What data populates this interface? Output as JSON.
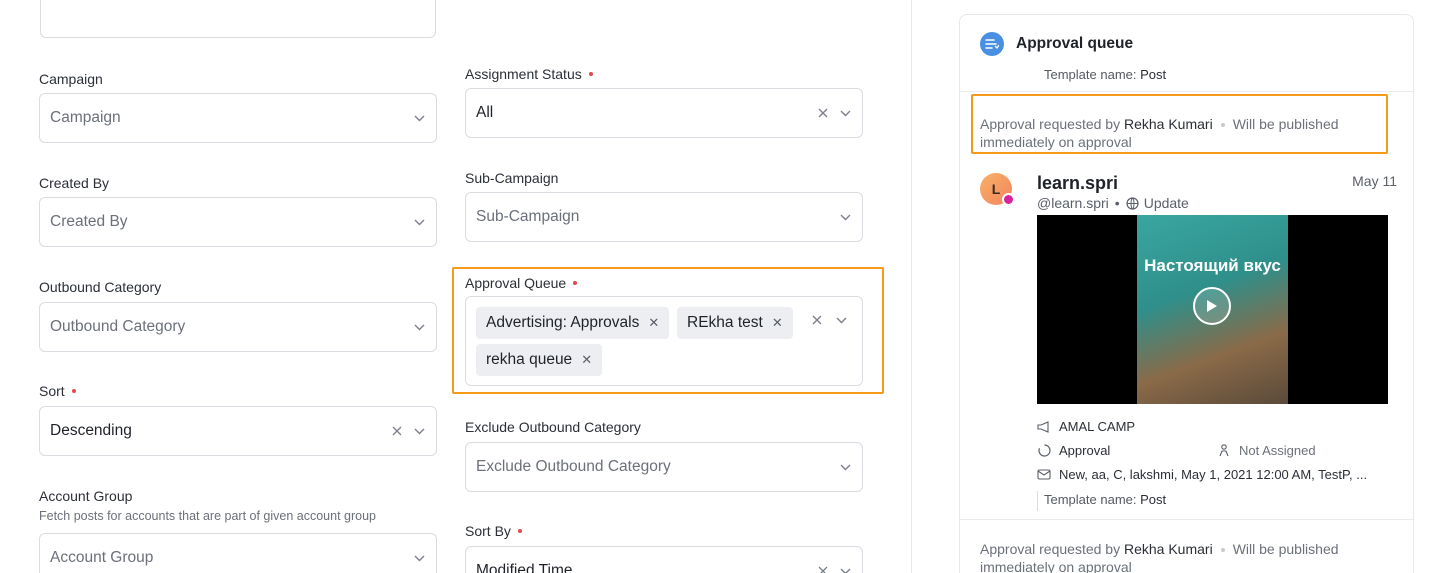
{
  "filters": {
    "campaign": {
      "label": "Campaign",
      "placeholder": "Campaign"
    },
    "created_by": {
      "label": "Created By",
      "placeholder": "Created By"
    },
    "outbound_category": {
      "label": "Outbound Category",
      "placeholder": "Outbound Category"
    },
    "sort": {
      "label": "Sort",
      "value": "Descending"
    },
    "account_group": {
      "label": "Account Group",
      "hint": "Fetch posts for accounts that are part of given account group",
      "placeholder": "Account Group"
    },
    "assignment_status": {
      "label": "Assignment Status",
      "value": "All"
    },
    "sub_campaign": {
      "label": "Sub-Campaign",
      "placeholder": "Sub-Campaign"
    },
    "approval_queue": {
      "label": "Approval Queue",
      "chips": [
        "Advertising: Approvals",
        "REkha test",
        "rekha queue"
      ]
    },
    "exclude_outbound_category": {
      "label": "Exclude Outbound Category",
      "placeholder": "Exclude Outbound Category"
    },
    "sort_by": {
      "label": "Sort By",
      "value": "Modified Time"
    }
  },
  "panel": {
    "title": "Approval queue",
    "template_prev": {
      "key": "Template name:",
      "value": "Post"
    },
    "request1": {
      "prefix": "Approval requested by",
      "who": "Rekha Kumari",
      "note": "Will be published immediately on approval"
    },
    "post": {
      "avatar_letter": "L",
      "account": "learn.spri",
      "handle": "@learn.spri",
      "type": "Update",
      "date": "May 11",
      "media_text": "Настоящий вкус",
      "campaign": "AMAL CAMP",
      "status": "Approval",
      "assignee": "Not Assigned",
      "tags": "New, aa, C, lakshmi, May 1, 2021 12:00 AM, TestP, ...",
      "template": {
        "key": "Template name:",
        "value": "Post"
      }
    },
    "request2": {
      "prefix": "Approval requested by",
      "who": "Rekha Kumari",
      "note": "Will be published immediately on approval"
    }
  },
  "colors": {
    "highlight": "#f59a1a",
    "required": "#e5484d",
    "chip_bg": "#eceef1"
  }
}
